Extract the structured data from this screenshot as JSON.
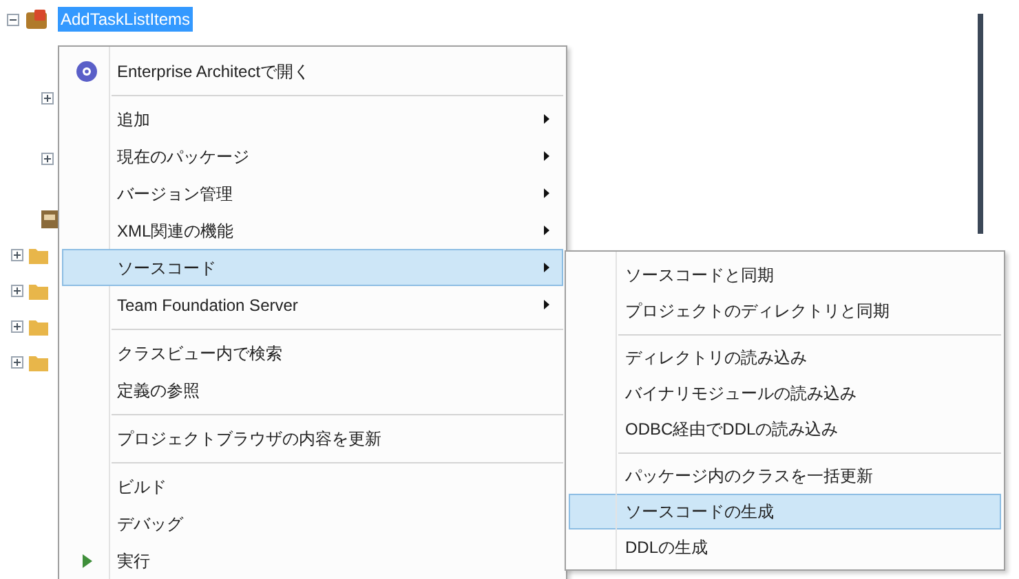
{
  "tree": {
    "items": [
      {
        "label": "AddTaskListItems",
        "selected": true,
        "kind": "class",
        "children": [
          {
            "kind": "node",
            "expanded": false
          },
          {
            "kind": "node",
            "expanded": false
          },
          {
            "kind": "package"
          }
        ]
      },
      {
        "kind": "folder",
        "expanded": false
      },
      {
        "kind": "folder",
        "expanded": false
      },
      {
        "kind": "folder",
        "expanded": false
      },
      {
        "kind": "folder",
        "expanded": false
      }
    ]
  },
  "context_menu": {
    "items": [
      {
        "kind": "item",
        "label": "Enterprise Architectで開く",
        "submenu": false,
        "selected": false
      },
      {
        "kind": "separator"
      },
      {
        "kind": "item",
        "label": "追加",
        "submenu": true,
        "selected": false
      },
      {
        "kind": "item",
        "label": "現在のパッケージ",
        "submenu": true,
        "selected": false
      },
      {
        "kind": "item",
        "label": "バージョン管理",
        "submenu": true,
        "selected": false
      },
      {
        "kind": "item",
        "label": "XML関連の機能",
        "submenu": true,
        "selected": false
      },
      {
        "kind": "item",
        "label": "ソースコード",
        "submenu": true,
        "selected": true
      },
      {
        "kind": "item",
        "label": "Team Foundation Server",
        "submenu": true,
        "selected": false
      },
      {
        "kind": "separator"
      },
      {
        "kind": "item",
        "label": "クラスビュー内で検索",
        "submenu": false,
        "selected": false
      },
      {
        "kind": "item",
        "label": "定義の参照",
        "submenu": false,
        "selected": false
      },
      {
        "kind": "separator"
      },
      {
        "kind": "item",
        "label": "プロジェクトブラウザの内容を更新",
        "submenu": false,
        "selected": false
      },
      {
        "kind": "separator"
      },
      {
        "kind": "item",
        "label": "ビルド",
        "submenu": false,
        "selected": false
      },
      {
        "kind": "item",
        "label": "デバッグ",
        "submenu": false,
        "selected": false
      },
      {
        "kind": "item",
        "label": "実行",
        "submenu": false,
        "selected": false
      }
    ]
  },
  "submenu": {
    "items": [
      {
        "kind": "item",
        "label": "ソースコードと同期",
        "selected": false
      },
      {
        "kind": "item",
        "label": "プロジェクトのディレクトリと同期",
        "selected": false
      },
      {
        "kind": "separator"
      },
      {
        "kind": "item",
        "label": "ディレクトリの読み込み",
        "selected": false
      },
      {
        "kind": "item",
        "label": "バイナリモジュールの読み込み",
        "selected": false
      },
      {
        "kind": "item",
        "label": "ODBC経由でDDLの読み込み",
        "selected": false
      },
      {
        "kind": "separator"
      },
      {
        "kind": "item",
        "label": "パッケージ内のクラスを一括更新",
        "selected": false
      },
      {
        "kind": "item",
        "label": "ソースコードの生成",
        "selected": true
      },
      {
        "kind": "item",
        "label": "DDLの生成",
        "selected": false
      }
    ]
  }
}
